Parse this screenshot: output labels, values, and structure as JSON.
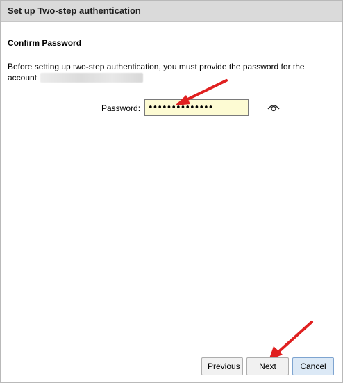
{
  "window": {
    "title": "Set up Two-step authentication"
  },
  "content": {
    "heading": "Confirm Password",
    "description": "Before setting up two-step authentication, you must provide the password for the account",
    "password_label": "Password:",
    "password_value": "••••••••••••••"
  },
  "footer": {
    "previous_label": "Previous",
    "next_label": "Next",
    "cancel_label": "Cancel"
  },
  "annotations": {
    "arrow_color": "#e02020"
  }
}
